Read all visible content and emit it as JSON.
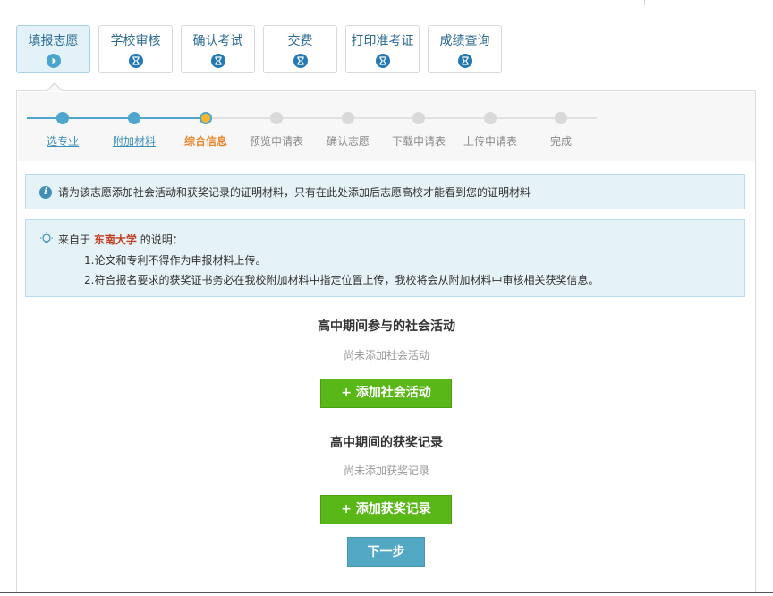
{
  "tabs": [
    {
      "label": "填报志愿",
      "icon": "play-icon",
      "active": true
    },
    {
      "label": "学校审核",
      "icon": "hourglass-icon",
      "active": false
    },
    {
      "label": "确认考试",
      "icon": "hourglass-icon",
      "active": false
    },
    {
      "label": "交费",
      "icon": "hourglass-icon",
      "active": false
    },
    {
      "label": "打印准考证",
      "icon": "hourglass-icon",
      "active": false
    },
    {
      "label": "成绩查询",
      "icon": "hourglass-icon",
      "active": false
    }
  ],
  "steps": [
    {
      "label": "选专业",
      "state": "done"
    },
    {
      "label": "附加材料",
      "state": "done"
    },
    {
      "label": "综合信息",
      "state": "current"
    },
    {
      "label": "预览申请表",
      "state": "todo"
    },
    {
      "label": "确认志愿",
      "state": "todo"
    },
    {
      "label": "下载申请表",
      "state": "todo"
    },
    {
      "label": "上传申请表",
      "state": "todo"
    },
    {
      "label": "完成",
      "state": "todo"
    }
  ],
  "info": {
    "text": "请为该志愿添加社会活动和获奖记录的证明材料，只有在此处添加后志愿高校才能看到您的证明材料"
  },
  "note": {
    "prefix": "来自于",
    "university": "东南大学",
    "suffix": "的说明：",
    "line1": "1.论文和专利不得作为申报材料上传。",
    "line2": "2.符合报名要求的获奖证书务必在我校附加材料中指定位置上传，我校将会从附加材料中审核相关获奖信息。"
  },
  "activities": {
    "title": "高中期间参与的社会活动",
    "empty": "尚未添加社会活动",
    "button": "+ 添加社会活动"
  },
  "awards": {
    "title": "高中期间的获奖记录",
    "empty": "尚未添加获奖记录",
    "button": "+ 添加获奖记录"
  },
  "next_button": "下一步",
  "colors": {
    "accent": "#4ea5cd",
    "current_step": "#e6872e",
    "green_button": "#59b718",
    "next_button": "#52a8c5",
    "university": "#c0401f"
  }
}
